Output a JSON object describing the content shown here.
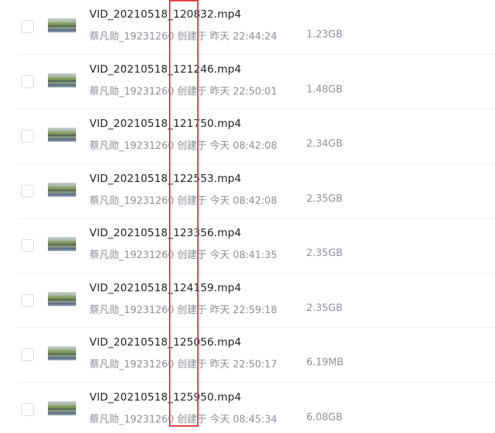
{
  "files": [
    {
      "name": "VID_20210518_120832.mp4",
      "owner": "蔡凡勋_19231260",
      "created_label": "创建于",
      "created_time": "昨天 22:44:24",
      "size": "1.23GB"
    },
    {
      "name": "VID_20210518_121246.mp4",
      "owner": "蔡凡勋_19231260",
      "created_label": "创建于",
      "created_time": "昨天 22:50:01",
      "size": "1.48GB"
    },
    {
      "name": "VID_20210518_121750.mp4",
      "owner": "蔡凡勋_19231260",
      "created_label": "创建于",
      "created_time": "今天 08:42:08",
      "size": "2.34GB"
    },
    {
      "name": "VID_20210518_122553.mp4",
      "owner": "蔡凡勋_19231260",
      "created_label": "创建于",
      "created_time": "今天 08:42:08",
      "size": "2.35GB"
    },
    {
      "name": "VID_20210518_123356.mp4",
      "owner": "蔡凡勋_19231260",
      "created_label": "创建于",
      "created_time": "今天 08:41:35",
      "size": "2.35GB"
    },
    {
      "name": "VID_20210518_124159.mp4",
      "owner": "蔡凡勋_19231260",
      "created_label": "创建于",
      "created_time": "昨天 22:59:18",
      "size": "2.35GB"
    },
    {
      "name": "VID_20210518_125056.mp4",
      "owner": "蔡凡勋_19231260",
      "created_label": "创建于",
      "created_time": "昨天 22:50:17",
      "size": "6.19MB"
    },
    {
      "name": "VID_20210518_125950.mp4",
      "owner": "蔡凡勋_19231260",
      "created_label": "创建于",
      "created_time": "今天 08:45:34",
      "size": "6.08GB"
    }
  ],
  "highlight_color": "#e53935"
}
